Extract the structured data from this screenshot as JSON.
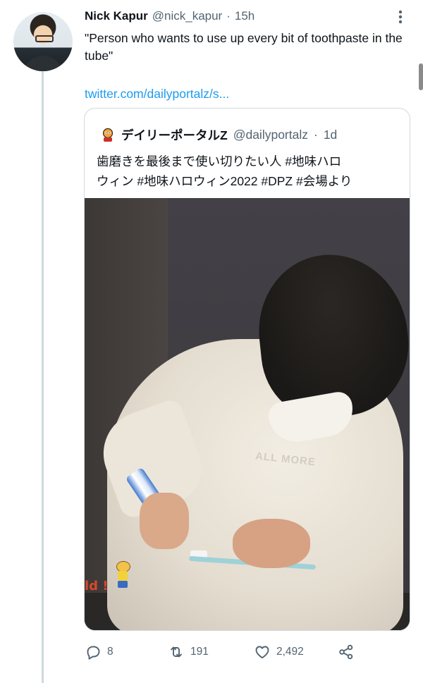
{
  "tweet": {
    "author_name": "Nick Kapur",
    "author_handle": "@nick_kapur",
    "separator": "·",
    "time": "15h",
    "text": "\"Person who wants to use up every bit of toothpaste in the tube\"",
    "link": "twitter.com/dailyportalz/s...",
    "more_icon": "more-vertical-icon"
  },
  "quote": {
    "avatar_icon": "dailyportalz-avatar-icon",
    "name": "デイリーポータルZ",
    "handle": "@dailyportalz",
    "separator": "·",
    "time": "1d",
    "text_line1": "歯磨きを最後まで使い切りたい人 #地味ハロ",
    "text_line2": "ウィン #地味ハロウィン2022 #DPZ #会場より",
    "photo": {
      "sticker_text": "ld !",
      "hoodie_text": "ALL MORE"
    }
  },
  "actions": {
    "replies": "8",
    "retweets": "191",
    "likes": "2,492",
    "reply_icon": "reply-icon",
    "retweet_icon": "retweet-icon",
    "like_icon": "heart-icon",
    "share_icon": "share-icon"
  },
  "colors": {
    "link": "#1d9bf0",
    "muted": "#536471",
    "text": "#0f1419",
    "border": "#cfd9de"
  }
}
